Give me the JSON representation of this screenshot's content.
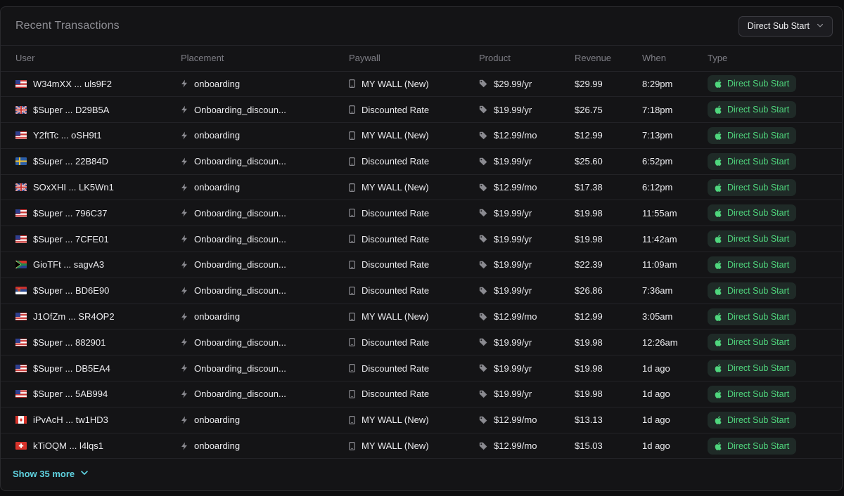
{
  "title": "Recent Transactions",
  "filter": {
    "label": "Direct Sub Start",
    "icon": "chevron-down-icon"
  },
  "columns": [
    "User",
    "Placement",
    "Paywall",
    "Product",
    "Revenue",
    "When",
    "Type"
  ],
  "rows": [
    {
      "flag": "us",
      "user": "W34mXX ... uls9F2",
      "placement": "onboarding",
      "paywall": "MY WALL (New)",
      "product": "$29.99/yr",
      "revenue": "$29.99",
      "when": "8:29pm",
      "type": "Direct Sub Start"
    },
    {
      "flag": "gb",
      "user": "$Super ... D29B5A",
      "placement": "Onboarding_discoun...",
      "paywall": "Discounted Rate",
      "product": "$19.99/yr",
      "revenue": "$26.75",
      "when": "7:18pm",
      "type": "Direct Sub Start"
    },
    {
      "flag": "us",
      "user": "Y2ftTc ... oSH9t1",
      "placement": "onboarding",
      "paywall": "MY WALL (New)",
      "product": "$12.99/mo",
      "revenue": "$12.99",
      "when": "7:13pm",
      "type": "Direct Sub Start"
    },
    {
      "flag": "se",
      "user": "$Super ... 22B84D",
      "placement": "Onboarding_discoun...",
      "paywall": "Discounted Rate",
      "product": "$19.99/yr",
      "revenue": "$25.60",
      "when": "6:52pm",
      "type": "Direct Sub Start"
    },
    {
      "flag": "gb",
      "user": "SOxXHI ... LK5Wn1",
      "placement": "onboarding",
      "paywall": "MY WALL (New)",
      "product": "$12.99/mo",
      "revenue": "$17.38",
      "when": "6:12pm",
      "type": "Direct Sub Start"
    },
    {
      "flag": "us",
      "user": "$Super ... 796C37",
      "placement": "Onboarding_discoun...",
      "paywall": "Discounted Rate",
      "product": "$19.99/yr",
      "revenue": "$19.98",
      "when": "11:55am",
      "type": "Direct Sub Start"
    },
    {
      "flag": "us",
      "user": "$Super ... 7CFE01",
      "placement": "Onboarding_discoun...",
      "paywall": "Discounted Rate",
      "product": "$19.99/yr",
      "revenue": "$19.98",
      "when": "11:42am",
      "type": "Direct Sub Start"
    },
    {
      "flag": "za",
      "user": "GioTFt ... sagvA3",
      "placement": "Onboarding_discoun...",
      "paywall": "Discounted Rate",
      "product": "$19.99/yr",
      "revenue": "$22.39",
      "when": "11:09am",
      "type": "Direct Sub Start"
    },
    {
      "flag": "rs",
      "user": "$Super ... BD6E90",
      "placement": "Onboarding_discoun...",
      "paywall": "Discounted Rate",
      "product": "$19.99/yr",
      "revenue": "$26.86",
      "when": "7:36am",
      "type": "Direct Sub Start"
    },
    {
      "flag": "us",
      "user": "J1OfZm ... SR4OP2",
      "placement": "onboarding",
      "paywall": "MY WALL (New)",
      "product": "$12.99/mo",
      "revenue": "$12.99",
      "when": "3:05am",
      "type": "Direct Sub Start"
    },
    {
      "flag": "us",
      "user": "$Super ... 882901",
      "placement": "Onboarding_discoun...",
      "paywall": "Discounted Rate",
      "product": "$19.99/yr",
      "revenue": "$19.98",
      "when": "12:26am",
      "type": "Direct Sub Start"
    },
    {
      "flag": "us",
      "user": "$Super ... DB5EA4",
      "placement": "Onboarding_discoun...",
      "paywall": "Discounted Rate",
      "product": "$19.99/yr",
      "revenue": "$19.98",
      "when": "1d ago",
      "type": "Direct Sub Start"
    },
    {
      "flag": "us",
      "user": "$Super ... 5AB994",
      "placement": "Onboarding_discoun...",
      "paywall": "Discounted Rate",
      "product": "$19.99/yr",
      "revenue": "$19.98",
      "when": "1d ago",
      "type": "Direct Sub Start"
    },
    {
      "flag": "ca",
      "user": "iPvAcH ... tw1HD3",
      "placement": "onboarding",
      "paywall": "MY WALL (New)",
      "product": "$12.99/mo",
      "revenue": "$13.13",
      "when": "1d ago",
      "type": "Direct Sub Start"
    },
    {
      "flag": "ch",
      "user": "kTiOQM ... l4lqs1",
      "placement": "onboarding",
      "paywall": "MY WALL (New)",
      "product": "$12.99/mo",
      "revenue": "$15.03",
      "when": "1d ago",
      "type": "Direct Sub Start"
    }
  ],
  "icons": {
    "placement": "bolt-icon",
    "paywall": "phone-icon",
    "product": "tag-icon",
    "type": "apple-icon"
  },
  "show_more": {
    "label": "Show 35 more",
    "icon": "chevron-down-icon"
  },
  "colors": {
    "background": "#0d0d0f",
    "panel": "#141416",
    "badge_bg": "#1f2a27",
    "badge_text": "#4fd67d",
    "link": "#5fd2e0"
  }
}
